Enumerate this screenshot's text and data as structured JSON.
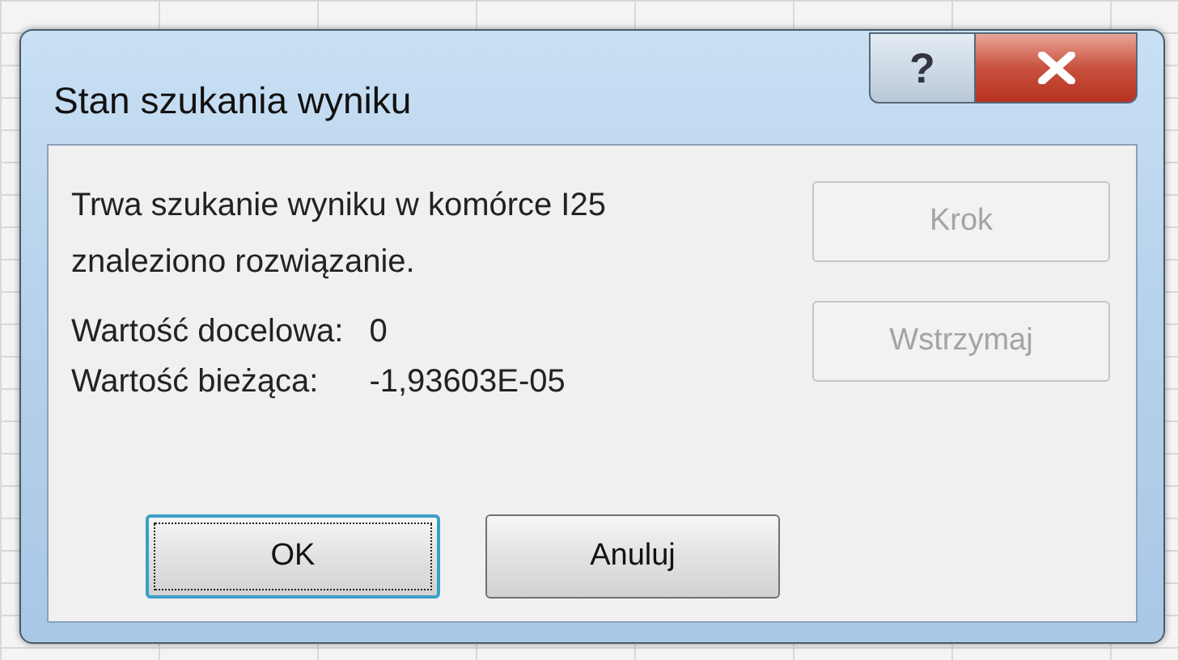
{
  "window": {
    "title": "Stan szukania wyniku",
    "caption_buttons": [
      {
        "kind": "help",
        "label": "?"
      },
      {
        "kind": "close"
      }
    ]
  },
  "message": "Trwa szukanie wyniku w komórce I25\nznaleziono rozwiązanie.",
  "fields": [
    {
      "label": "Wartość docelowa:",
      "value": "0"
    },
    {
      "label": "Wartość bieżąca:",
      "value": "-1,93603E-05"
    }
  ],
  "side_buttons": [
    {
      "label": "Krok",
      "disabled": true
    },
    {
      "label": "Wstrzymaj",
      "disabled": true
    }
  ],
  "buttons": [
    {
      "label": "OK",
      "focused": true
    },
    {
      "label": "Anuluj",
      "focused": false
    }
  ]
}
